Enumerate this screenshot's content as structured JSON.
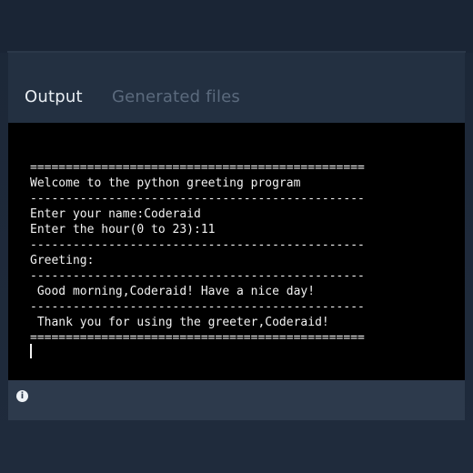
{
  "tabs": {
    "output": "Output",
    "generated_files": "Generated files"
  },
  "console": {
    "lines": [
      "===============================================",
      "Welcome to the python greeting program",
      "-----------------------------------------------",
      "Enter your name:Coderaid",
      "Enter the hour(0 to 23):11",
      "-----------------------------------------------",
      "Greeting:",
      "-----------------------------------------------",
      " Good morning,Coderaid! Have a nice day!",
      "-----------------------------------------------",
      " Thank you for using the greeter,Coderaid!",
      "==============================================="
    ]
  },
  "footer": {
    "info_icon_glyph": "i"
  },
  "icons": {
    "info": "info-icon"
  }
}
